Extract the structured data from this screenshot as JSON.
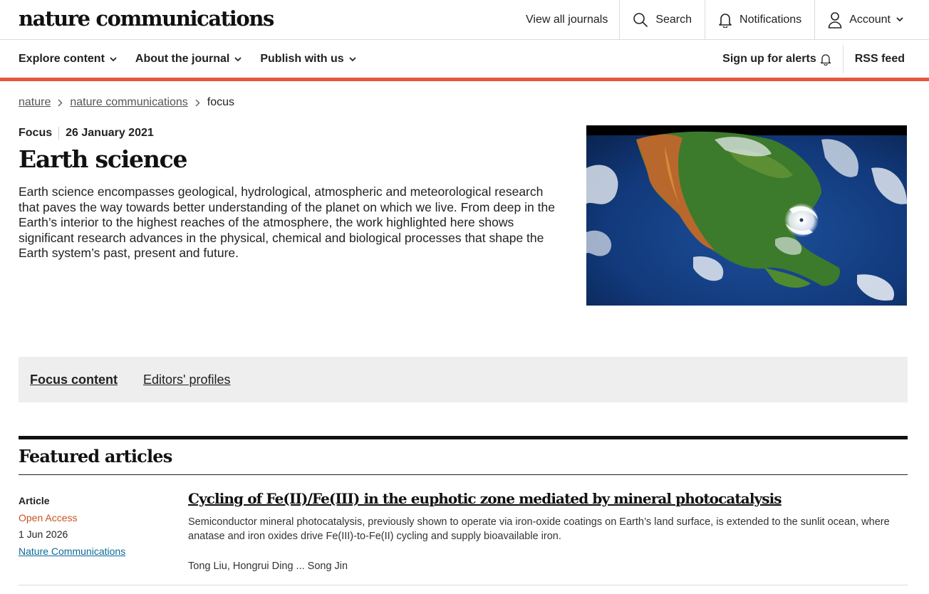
{
  "header": {
    "logo": "nature communications",
    "view_all_journals": "View all journals",
    "search": "Search",
    "notifications": "Notifications",
    "account": "Account"
  },
  "subnav": {
    "explore_content": "Explore content",
    "about_journal": "About the journal",
    "publish_with_us": "Publish with us",
    "sign_up_alerts": "Sign up for alerts",
    "rss_feed": "RSS feed"
  },
  "breadcrumb": {
    "items": [
      "nature",
      "nature communications"
    ],
    "current": "focus"
  },
  "hero": {
    "type": "Focus",
    "date": "26 January 2021",
    "title": "Earth science",
    "description": "Earth science encompasses geological, hydrological, atmospheric and meteorological research that paves the way towards better understanding of the planet on which we live. From deep in the Earth’s interior to the highest reaches of the atmosphere, the work highlighted here shows significant research advances in the physical, chemical and biological processes that shape the Earth system’s past, present and future."
  },
  "tabs": [
    {
      "label": "Focus content",
      "active": true
    },
    {
      "label": "Editors' profiles",
      "active": false
    }
  ],
  "featured": {
    "heading": "Featured articles",
    "articles": [
      {
        "type": "Article",
        "access": "Open Access",
        "date": "1 Jun 2026",
        "journal": "Nature Communications",
        "title": "Cycling of Fe(II)/Fe(III) in the euphotic zone mediated by mineral photocatalysis",
        "description": "Semiconductor mineral photocatalysis, previously shown to operate via iron-oxide coatings on Earth’s land surface, is extended to the sunlit ocean, where anatase and iron oxides drive Fe(III)-to-Fe(II) cycling and supply bioavailable iron.",
        "authors": "Tong Liu, Hongrui Ding ... Song Jin"
      }
    ]
  },
  "colors": {
    "accent": "#e6563c",
    "open_access": "#c9531f",
    "link": "#0c6a9a"
  }
}
